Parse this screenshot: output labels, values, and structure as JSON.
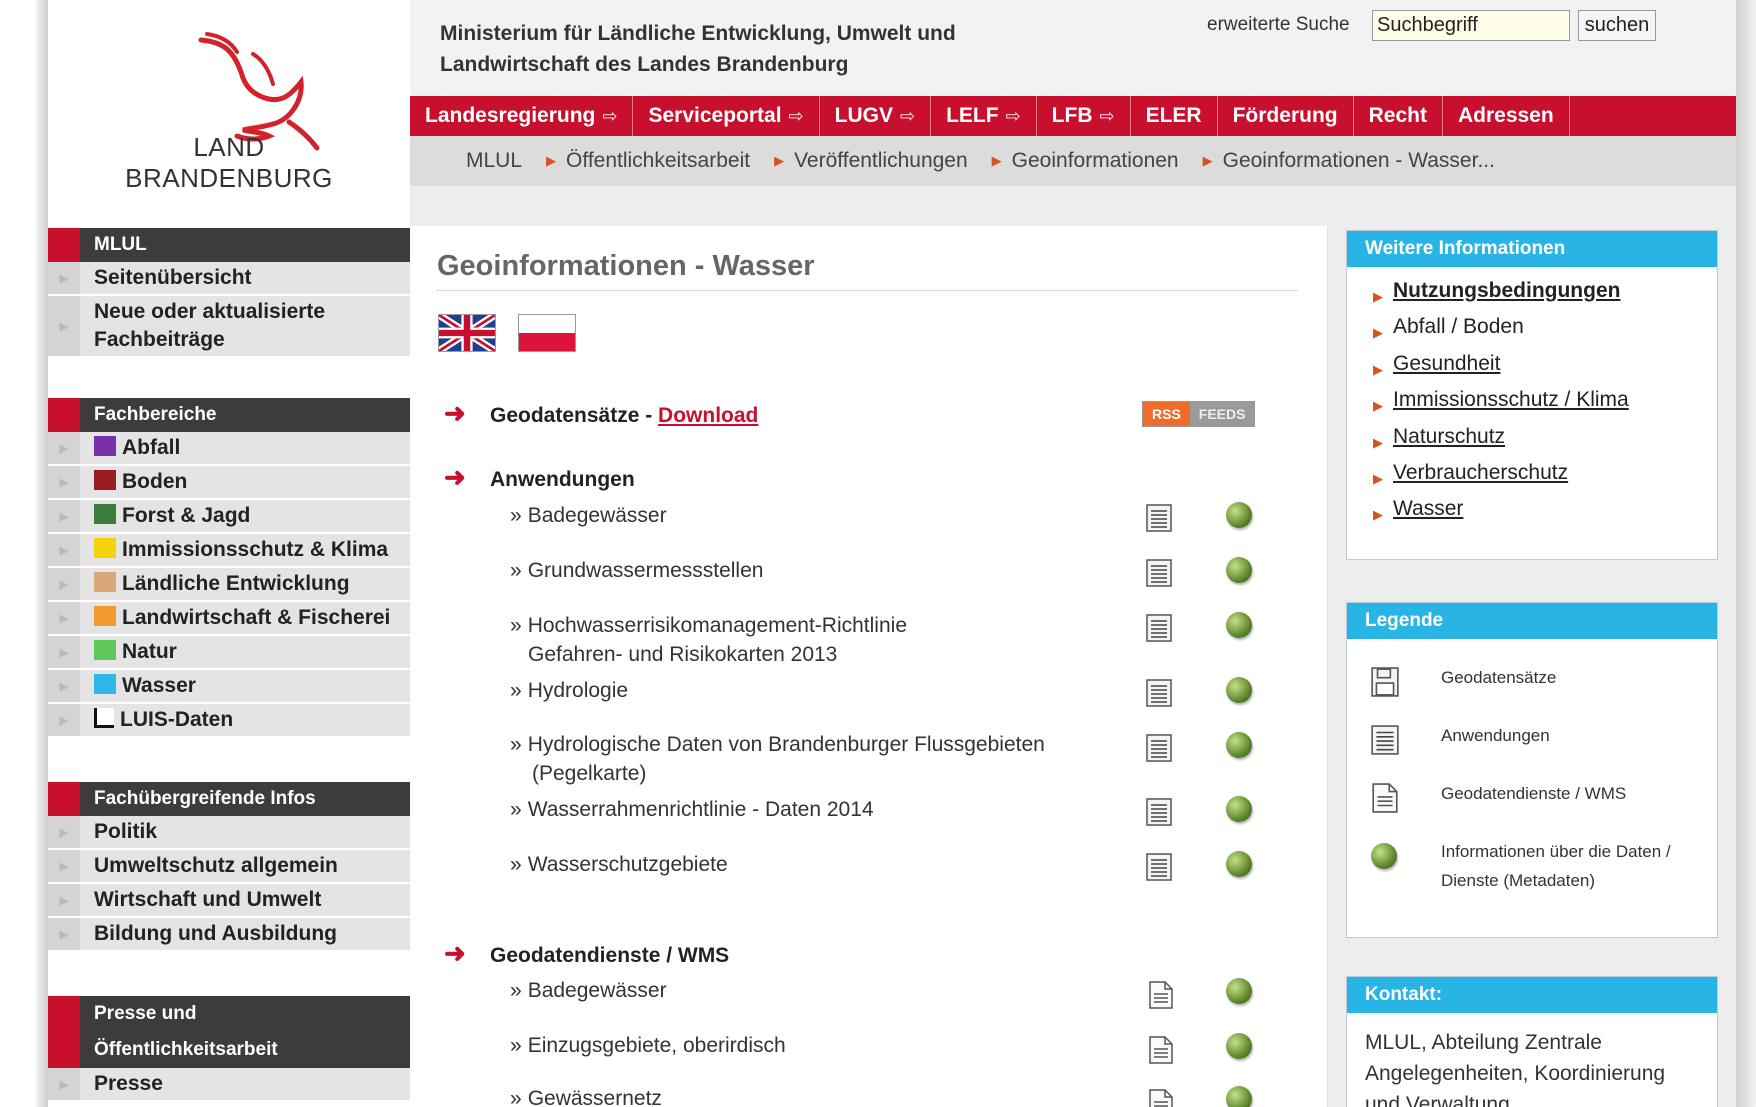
{
  "logo": {
    "line1": "LAND",
    "line2": "BRANDENBURG"
  },
  "header": {
    "ministry_line1": "Ministerium für Ländliche Entwicklung, Umwelt und",
    "ministry_line2": "Landwirtschaft des Landes Brandenburg",
    "search_label": "erweiterte Suche",
    "search_value": "Suchbegriff",
    "search_button": "suchen"
  },
  "topnav": [
    {
      "label": "Landesregierung",
      "ext": "⇨"
    },
    {
      "label": "Serviceportal",
      "ext": "⇨"
    },
    {
      "label": "LUGV",
      "ext": "⇨"
    },
    {
      "label": "LELF",
      "ext": "⇨"
    },
    {
      "label": "LFB",
      "ext": "⇨"
    },
    {
      "label": "ELER",
      "ext": ""
    },
    {
      "label": "Förderung",
      "ext": ""
    },
    {
      "label": "Recht",
      "ext": ""
    },
    {
      "label": "Adressen",
      "ext": ""
    }
  ],
  "breadcrumb": [
    "MLUL",
    "Öffentlichkeitsarbeit",
    "Veröffentlichungen",
    "Geoinformationen",
    "Geoinformationen - Wasser..."
  ],
  "sidebar": {
    "mlul_head": "MLUL",
    "mlul_items": [
      "Seitenübersicht",
      "Neue oder aktualisierte",
      "Fachbeiträge"
    ],
    "fach_head": "Fachbereiche",
    "fach_items": [
      {
        "label": "Abfall",
        "color": "#7b2fa8"
      },
      {
        "label": "Boden",
        "color": "#9c1b22"
      },
      {
        "label": "Forst & Jagd",
        "color": "#3a7d3a"
      },
      {
        "label": "Immissionsschutz & Klima",
        "color": "#f5d20a"
      },
      {
        "label": "Ländliche Entwicklung",
        "color": "#d8a777"
      },
      {
        "label": "Landwirtschaft & Fischerei",
        "color": "#f29a2e"
      },
      {
        "label": "Natur",
        "color": "#5ec65a"
      },
      {
        "label": "Wasser",
        "color": "#2fb7ea"
      },
      {
        "label": "LUIS-Daten",
        "color": "#111111"
      }
    ],
    "ueber_head": "Fachübergreifende Infos",
    "ueber_items": [
      "Politik",
      "Umweltschutz allgemein",
      "Wirtschaft und Umwelt",
      "Bildung und Ausbildung"
    ],
    "presse_head_1": "Presse und",
    "presse_head_2": "Öffentlichkeitsarbeit",
    "presse_items": [
      "Presse"
    ]
  },
  "main": {
    "title": "Geoinformationen - Wasser",
    "geodaten_label": "Geodatensätze - ",
    "geodaten_link": "Download",
    "rss_a": "RSS",
    "rss_b": "FEEDS",
    "anwendungen_head": "Anwendungen",
    "anwendungen": [
      "Badegewässer",
      "Grundwassermessstellen",
      "Hochwasserrisikomanagement-Richtlinie",
      "Gefahren- und Risikokarten 2013",
      "Hydrologie",
      "Hydrologische Daten von Brandenburger Flussgebieten",
      "(Pegelkarte)",
      "Wasserrahmenrichtlinie - Daten 2014",
      "Wasserschutzgebiete"
    ],
    "wms_head": "Geodatendienste / WMS",
    "wms": [
      "Badegewässer",
      "Einzugsgebiete, oberirdisch",
      "Gewässernetz"
    ],
    "bullet": "»"
  },
  "right": {
    "info_head": "Weitere Informationen",
    "info_links": [
      "Nutzungsbedingungen",
      "Abfall / Boden",
      "Gesundheit",
      "Immissionsschutz / Klima",
      "Naturschutz",
      "Verbraucherschutz",
      "Wasser"
    ],
    "legend_head": "Legende",
    "legend_items": [
      "Geodatensätze",
      "Anwendungen",
      "Geodatendienste / WMS",
      "Informationen über die Daten /",
      "Dienste (Metadaten)"
    ],
    "contact_head": "Kontakt:",
    "contact_lines": [
      "MLUL, Abteilung Zentrale",
      "Angelegenheiten, Koordinierung",
      "und Verwaltung"
    ]
  }
}
